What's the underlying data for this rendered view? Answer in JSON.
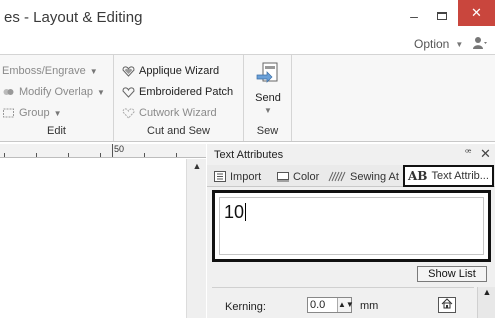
{
  "window": {
    "title": "es - Layout & Editing",
    "minimize": "–",
    "close": "✕"
  },
  "option_menu": {
    "label": "Option"
  },
  "ribbon": {
    "edit_group": {
      "label": "Edit",
      "items": [
        "Emboss/Engrave",
        "Modify Overlap",
        "Group"
      ]
    },
    "cut_and_sew_group": {
      "label": "Cut and Sew",
      "items": [
        "Applique Wizard",
        "Embroidered Patch",
        "Cutwork Wizard"
      ]
    },
    "sew_group": {
      "label": "Sew",
      "send_label": "Send"
    }
  },
  "ruler": {
    "mark": "50"
  },
  "panel": {
    "title": "Text Attributes",
    "pin": "ꟹ",
    "close": "✕",
    "tabs": [
      "Import",
      "Color",
      "Sewing At",
      "Text Attrib..."
    ],
    "text_value": "10",
    "show_list_label": "Show List",
    "kerning": {
      "label": "Kerning:",
      "value": "0.0",
      "unit": "mm"
    }
  }
}
